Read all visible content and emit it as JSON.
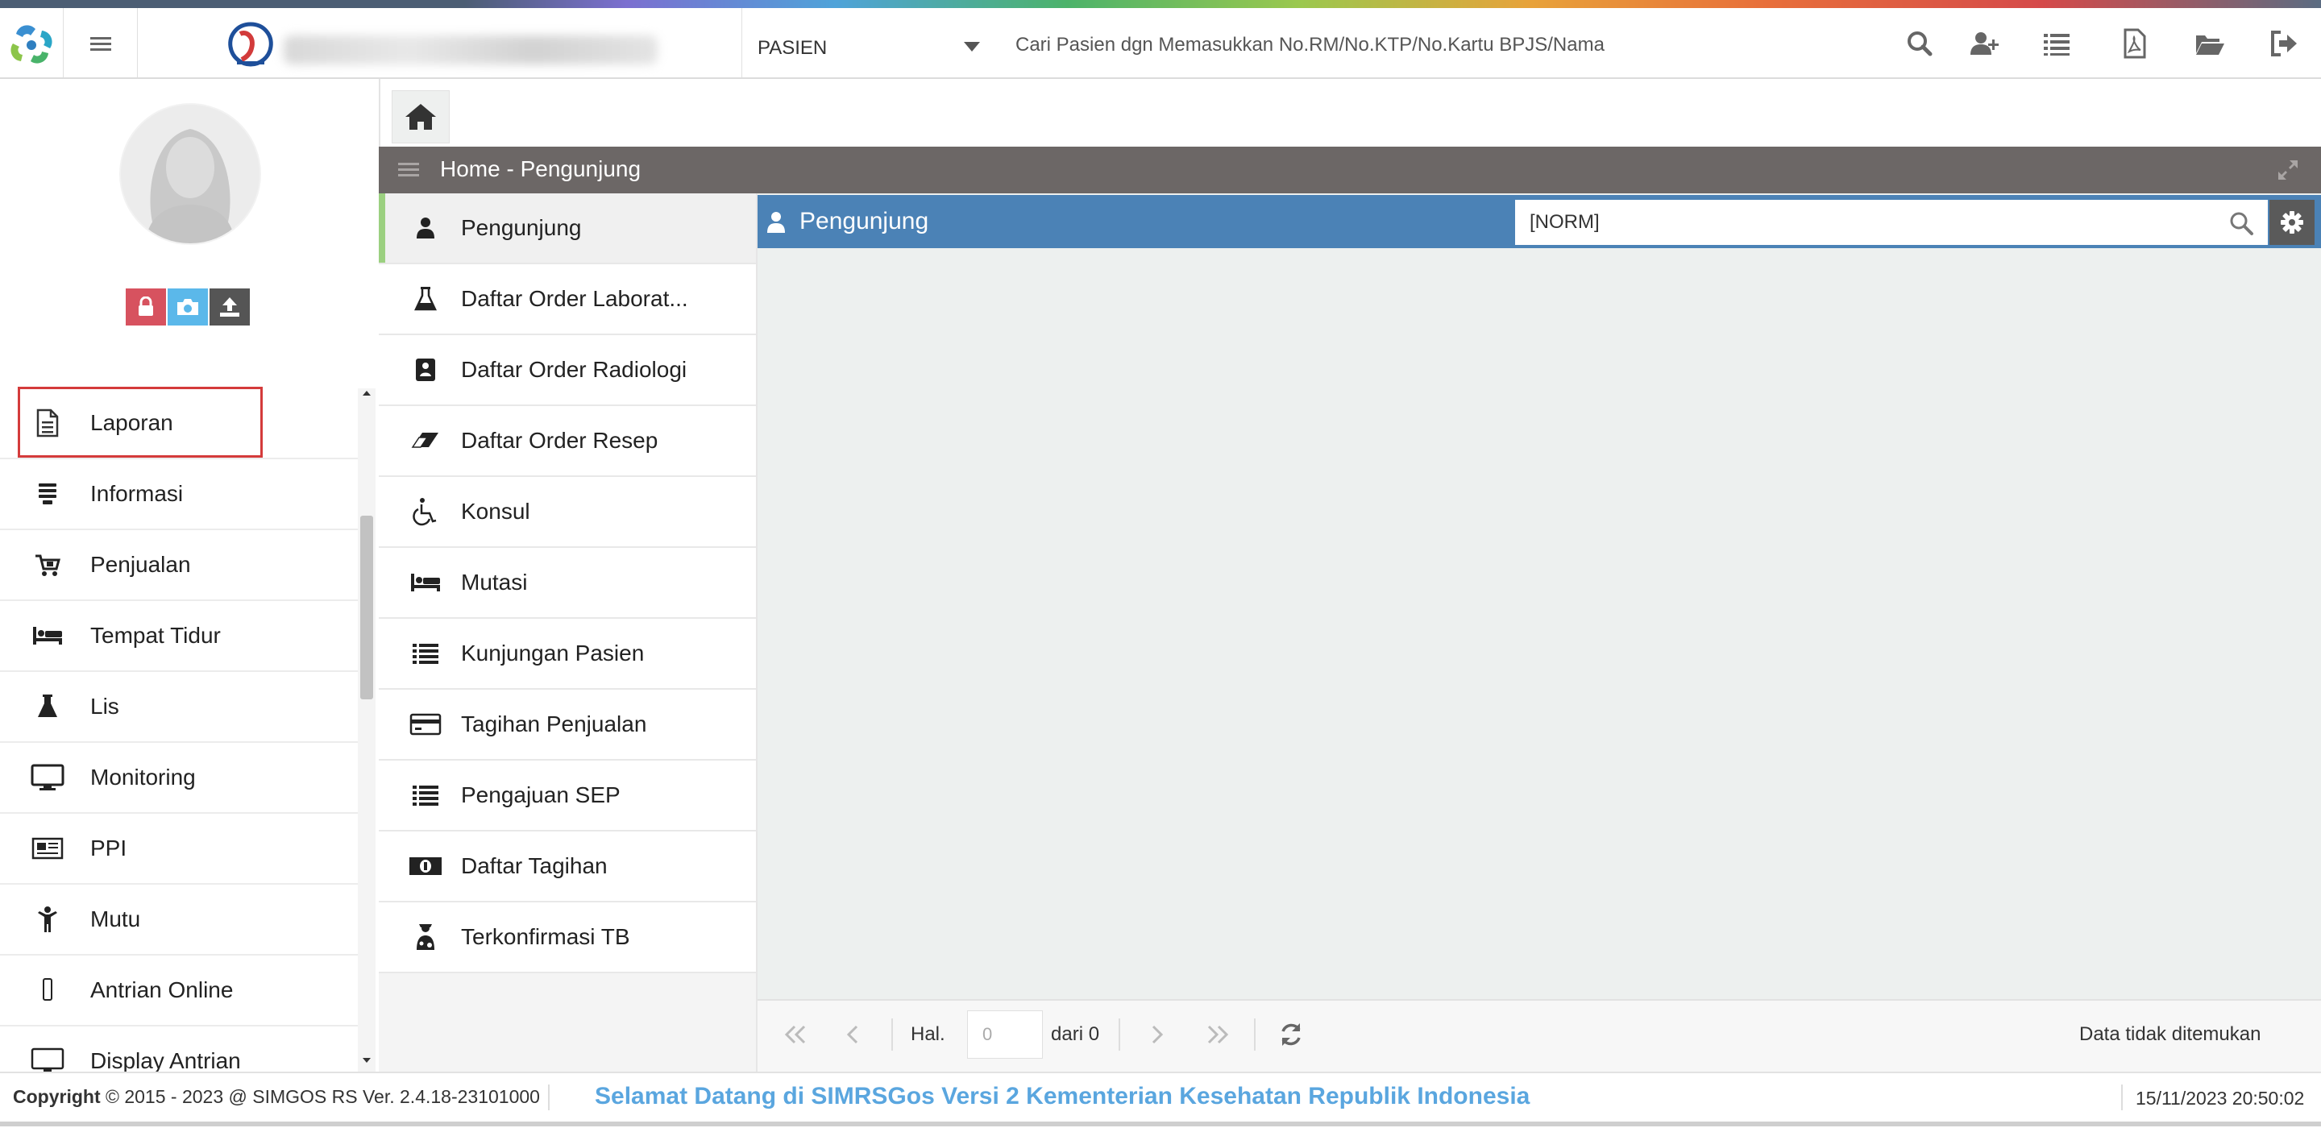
{
  "topbar": {
    "search_type": "PASIEN",
    "search_placeholder": "Cari Pasien dgn Memasukkan No.RM/No.KTP/No.Kartu BPJS/Nama",
    "icons": [
      "search-icon",
      "add-user-icon",
      "list-icon",
      "pdf-icon",
      "folder-open-icon",
      "logout-icon"
    ]
  },
  "sidebar": {
    "avatar_actions": [
      "lock-icon",
      "camera-icon",
      "upload-icon"
    ],
    "items": [
      {
        "label": "Laporan",
        "icon": "document-icon"
      },
      {
        "label": "Informasi",
        "icon": "info-list-icon"
      },
      {
        "label": "Penjualan",
        "icon": "cart-icon"
      },
      {
        "label": "Tempat Tidur",
        "icon": "bed-icon"
      },
      {
        "label": "Lis",
        "icon": "flask-icon"
      },
      {
        "label": "Monitoring",
        "icon": "monitor-icon"
      },
      {
        "label": "PPI",
        "icon": "newspaper-icon"
      },
      {
        "label": "Mutu",
        "icon": "child-icon"
      },
      {
        "label": "Antrian Online",
        "icon": "mobile-icon"
      },
      {
        "label": "Display Antrian",
        "icon": "desktop-icon"
      }
    ]
  },
  "panel": {
    "title": "Home - Pengunjung"
  },
  "submenu": {
    "items": [
      {
        "label": "Pengunjung",
        "icon": "user-icon"
      },
      {
        "label": "Daftar Order Laborat...",
        "icon": "flask-icon"
      },
      {
        "label": "Daftar Order Radiologi",
        "icon": "xray-icon"
      },
      {
        "label": "Daftar Order Resep",
        "icon": "eraser-icon"
      },
      {
        "label": "Konsul",
        "icon": "wheelchair-icon"
      },
      {
        "label": "Mutasi",
        "icon": "bed-icon"
      },
      {
        "label": "Kunjungan Pasien",
        "icon": "list-icon"
      },
      {
        "label": "Tagihan Penjualan",
        "icon": "credit-card-icon"
      },
      {
        "label": "Pengajuan SEP",
        "icon": "list-icon"
      },
      {
        "label": "Daftar Tagihan",
        "icon": "money-icon"
      },
      {
        "label": "Terkonfirmasi TB",
        "icon": "patient-icon"
      }
    ]
  },
  "content": {
    "title": "Pengunjung",
    "filter_value": "[NORM]"
  },
  "pager": {
    "hal_label": "Hal.",
    "page_value": "0",
    "dari_label": "dari 0",
    "status": "Data tidak ditemukan"
  },
  "footer": {
    "copyright_label": "Copyright",
    "copyright_text": "2015 - 2023 @ SIMGOS RS Ver. 2.4.18-23101000",
    "welcome": "Selamat Datang di SIMRSGos Versi 2 Kementerian Kesehatan Republik Indonesia",
    "datetime": "15/11/2023 20:50:02"
  },
  "colors": {
    "header_gray": "#6c6766",
    "content_blue": "#4b82b6",
    "active_accent": "#9bd080",
    "highlight_red": "#d43b3b",
    "welcome_blue": "#5aa6df"
  }
}
